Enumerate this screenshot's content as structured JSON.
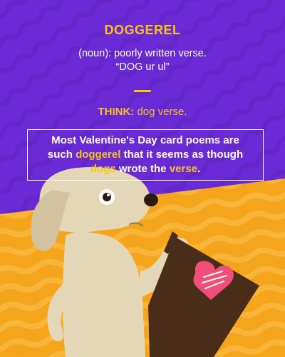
{
  "word": "DOGGEREL",
  "definition": {
    "line1": "(noun): poorly written verse.",
    "line2": "“DOG ur ul”"
  },
  "think": {
    "label": "THINK:",
    "value": "dog verse."
  },
  "example": {
    "part1": "Most Valentine's Day card poems are such ",
    "highlight1": "doggerel",
    "part2": " that it seems as though ",
    "highlight2": "dogs",
    "part3": " wrote the ",
    "highlight3": "verse",
    "part4": "."
  },
  "colors": {
    "background_purple": "#6a2bd6",
    "accent_yellow": "#f6c21b",
    "orange_ground": "#f4a51c",
    "dog_body": "#e3d7b8",
    "card_brown": "#4a2d19",
    "heart_pink": "#ef4f78"
  },
  "icons": [
    "dog-illustration",
    "valentine-card-icon",
    "heart-icon"
  ]
}
